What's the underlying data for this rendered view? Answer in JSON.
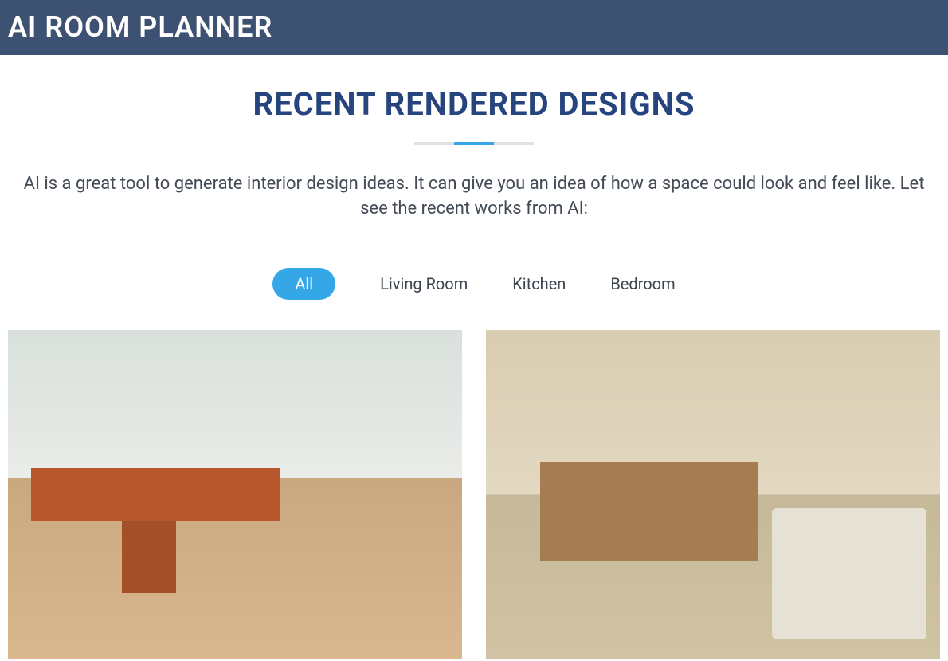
{
  "header": {
    "title": "AI ROOM PLANNER"
  },
  "section": {
    "title": "RECENT RENDERED DESIGNS",
    "description": "AI is a great tool to generate interior design ideas. It can give you an idea of how a space could look and feel like. Let see the recent works from AI:"
  },
  "filters": {
    "active_index": 0,
    "items": [
      {
        "label": "All"
      },
      {
        "label": "Living Room"
      },
      {
        "label": "Kitchen"
      },
      {
        "label": "Bedroom"
      }
    ]
  },
  "gallery": {
    "items": [
      {
        "alt": "Room with plants and wooden floor"
      },
      {
        "alt": "Scandinavian living room with sofa and shelving"
      }
    ]
  }
}
